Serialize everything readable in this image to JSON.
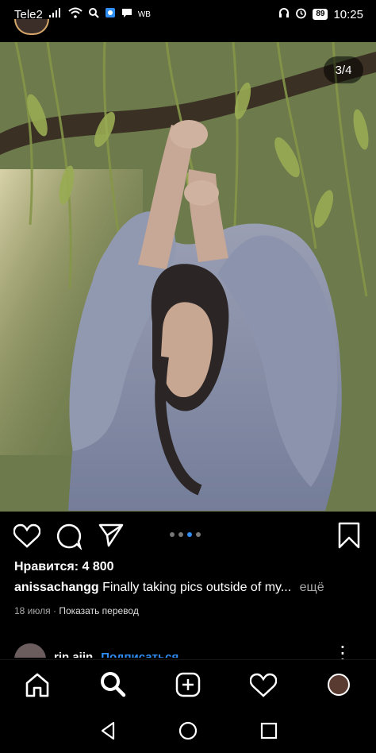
{
  "status_bar": {
    "carrier": "Tele2",
    "wb_label": "WB",
    "battery": "89",
    "time": "10:25"
  },
  "post": {
    "counter": "3/4",
    "likes": "Нравится: 4 800",
    "caption_user": "anissachangg",
    "caption_text": "Finally taking pics outside of my...",
    "caption_more": "ещё",
    "date": "18 июля",
    "translate": "Показать перевод",
    "carousel": {
      "total": 4,
      "active_index": 2
    }
  },
  "comment_peek": {
    "user": "rin.ajin",
    "follow": "Подписаться"
  },
  "colors": {
    "accent": "#2f8df6",
    "muted": "#a8a8a8",
    "background": "#000000"
  },
  "icons": {
    "like": "heart-icon",
    "comment": "comment-icon",
    "share": "send-icon",
    "save": "bookmark-icon",
    "home": "home-icon",
    "search": "search-icon",
    "create": "add-icon",
    "activity": "heart-icon",
    "profile": "avatar",
    "back": "back-icon",
    "android_home": "home-circle-icon",
    "recents": "recents-icon"
  }
}
